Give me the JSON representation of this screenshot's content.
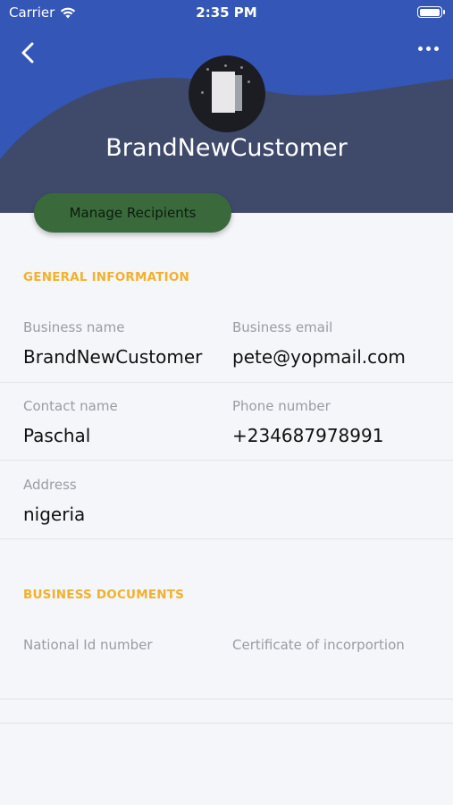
{
  "status_bar": {
    "carrier": "Carrier",
    "time": "2:35 PM"
  },
  "header": {
    "back_icon": "chevron-left-icon",
    "more_icon": "more-horizontal-icon",
    "profile_name": "BrandNewCustomer",
    "colors": {
      "top_wave": "#3456b6",
      "bottom": "#3f4a6b"
    }
  },
  "actions": {
    "manage_recipients_label": "Manage Recipients",
    "color": "#3a6a3c"
  },
  "general_information": {
    "title": "GENERAL INFORMATION",
    "business_name_label": "Business name",
    "business_name_value": "BrandNewCustomer",
    "business_email_label": "Business email",
    "business_email_value": "pete@yopmail.com",
    "contact_name_label": "Contact name",
    "contact_name_value": "Paschal",
    "phone_number_label": "Phone number",
    "phone_number_value": "+234687978991",
    "address_label": "Address",
    "address_value": "nigeria"
  },
  "business_documents": {
    "title": "BUSINESS DOCUMENTS",
    "national_id_label": "National Id number",
    "certificate_label": "Certificate of incorpor­tion"
  }
}
